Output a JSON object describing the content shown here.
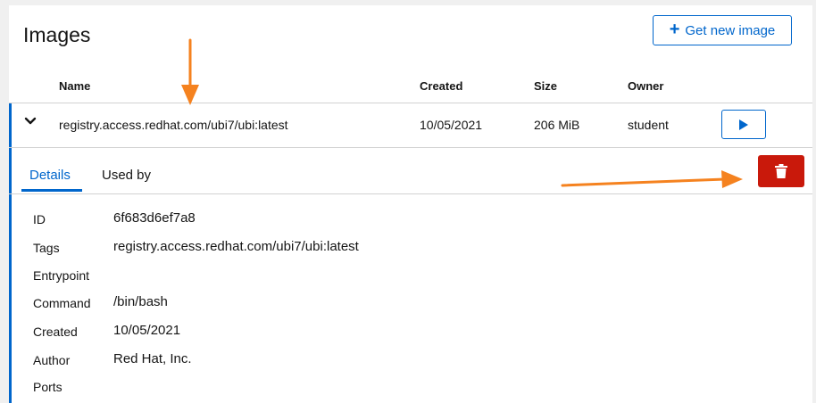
{
  "page": {
    "title": "Images"
  },
  "toolbar": {
    "get_new_image_label": "Get new image"
  },
  "table": {
    "headers": {
      "name": "Name",
      "created": "Created",
      "size": "Size",
      "owner": "Owner"
    },
    "row": {
      "name": "registry.access.redhat.com/ubi7/ubi:latest",
      "created": "10/05/2021",
      "size": "206 MiB",
      "owner": "student"
    }
  },
  "tabs": [
    {
      "label": "Details",
      "active": true
    },
    {
      "label": "Used by",
      "active": false
    }
  ],
  "details": [
    {
      "label": "ID",
      "value": "6f683d6ef7a8"
    },
    {
      "label": "Tags",
      "value": "registry.access.redhat.com/ubi7/ubi:latest"
    },
    {
      "label": "Entrypoint",
      "value": ""
    },
    {
      "label": "Command",
      "value": "/bin/bash"
    },
    {
      "label": "Created",
      "value": "10/05/2021"
    },
    {
      "label": "Author",
      "value": "Red Hat, Inc."
    },
    {
      "label": "Ports",
      "value": ""
    }
  ],
  "colors": {
    "accent": "#0066cc",
    "danger": "#c9190b",
    "annotation": "#f5821f"
  },
  "icons": {
    "expand": "chevron-down-icon",
    "run": "play-icon",
    "delete": "trash-icon",
    "add": "plus-icon"
  }
}
